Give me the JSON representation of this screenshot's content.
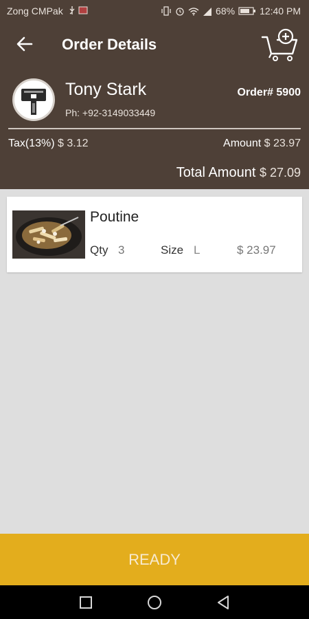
{
  "status_bar": {
    "carrier": "Zong CMPak",
    "battery": "68%",
    "time": "12:40 PM",
    "icons": [
      "usb-icon",
      "sim-icon",
      "vibrate-icon",
      "alarm-icon",
      "wifi-icon",
      "signal-icon",
      "battery-icon"
    ]
  },
  "header": {
    "title": "Order Details",
    "back_icon": "arrow-left-icon",
    "cart_icon": "cart-add-icon"
  },
  "customer": {
    "name": "Tony Stark",
    "phone": "Ph: +92-3149033449",
    "order_number": "Order# 5900"
  },
  "summary": {
    "tax_label": "Tax(13%)",
    "tax_value": "$ 3.12",
    "amount_label": "Amount",
    "amount_value": "$ 23.97",
    "total_label": "Total Amount",
    "total_value": "$ 27.09"
  },
  "items": [
    {
      "name": "Poutine",
      "qty_label": "Qty",
      "qty": "3",
      "size_label": "Size",
      "size": "L",
      "price": "$ 23.97"
    }
  ],
  "actions": {
    "ready_label": "READY"
  },
  "colors": {
    "header_bg": "#4e4037",
    "accent": "#e3ad1d",
    "page_bg": "#dedede"
  }
}
